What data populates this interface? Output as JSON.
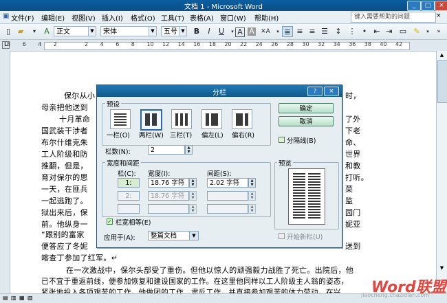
{
  "window": {
    "title": "文档 1 - Microsoft Word"
  },
  "menu": {
    "items": [
      "文件(F)",
      "编辑(E)",
      "视图(V)",
      "插入(I)",
      "格式(O)",
      "工具(T)",
      "表格(A)",
      "窗口(W)",
      "帮助(H)"
    ],
    "help_placeholder": "键入需要帮助的问题"
  },
  "toolbar": {
    "style": "正文",
    "font": "宋体",
    "size": "五号",
    "bold": "B",
    "italic": "I",
    "underline": "U",
    "charbox": "A",
    "scale": "A"
  },
  "ruler": {
    "numbers": [
      "8",
      "6",
      "4",
      "2",
      "",
      "2",
      "4",
      "6",
      "8",
      "10",
      "12",
      "14",
      "16",
      "18",
      "20",
      "22",
      "24",
      "26",
      "28",
      "30",
      "32",
      "34",
      "36",
      "38",
      "40",
      "42"
    ]
  },
  "document": {
    "lines": [
      "保尔从小",
      "母亲把他送到",
      "十月革命",
      "国武装干涉者",
      "布尔什维克朱",
      "工人阶级和防",
      "推翻，但是，",
      "育对保尔的思",
      "一天，在匪兵",
      "一起逃跑了。",
      "狱出来后，保",
      "前。他纵身一",
      "“跟别的富家",
      "便答应了冬妮",
      "喀查丁参加了红军。↵",
      "在一次激战中，保尔头部受了重伤。但他以惊人的顽强毅力战胜了死亡。出院后，他",
      "已不宜于重返前线，便参加恢复和建设国家的工作。在这里他同样以工人阶级主人翁的姿态，",
      "紧张地投入各项艰苦的工作。他做团的工作、肃反工作，并直接参加艰苦的体力劳动。在兴"
    ],
    "right_fragments": [
      "时，",
      "了外",
      "下老",
      "命、",
      "世界",
      "和教",
      "打听。",
      "菜",
      "监",
      "园门",
      "妮亚",
      "送到"
    ]
  },
  "dialog": {
    "title": "分栏",
    "preset_label": "预设",
    "presets": [
      "一栏(O)",
      "两栏(W)",
      "三栏(T)",
      "偏左(L)",
      "偏右(R)"
    ],
    "ok": "确定",
    "cancel": "取消",
    "divider_label": "分隔线(B)",
    "columns_label": "栏数(N):",
    "columns_value": "2",
    "width_spacing_label": "宽度和间距",
    "col_header": "栏(C):",
    "width_header": "宽度(I):",
    "spacing_header": "间距(S):",
    "rows": [
      {
        "col": "1:",
        "width": "18.76 字符",
        "spacing": "2.02 字符"
      },
      {
        "col": "2:",
        "width": "18.76 字符",
        "spacing": ""
      },
      {
        "col": "",
        "width": "",
        "spacing": ""
      }
    ],
    "equal_width_label": "栏宽相等(E)",
    "apply_label": "应用于(A):",
    "apply_value": "整篇文档",
    "preview_label": "预览",
    "new_column_label": "开始新栏(U)"
  },
  "watermark": {
    "brand": "Word联盟",
    "url": "jiaocheng.chazidian.com"
  }
}
